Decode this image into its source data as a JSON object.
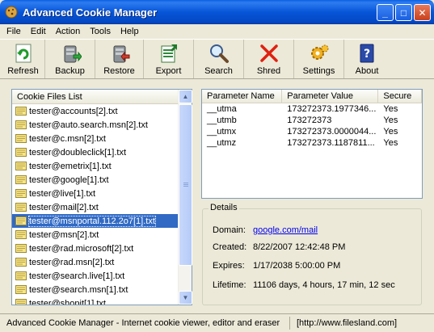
{
  "window": {
    "title": "Advanced Cookie Manager",
    "minimize": "_",
    "maximize": "□",
    "close": "✕"
  },
  "menu": [
    "File",
    "Edit",
    "Action",
    "Tools",
    "Help"
  ],
  "toolbar": [
    {
      "label": "Refresh",
      "icon": "refresh-icon"
    },
    {
      "label": "Backup",
      "icon": "backup-icon"
    },
    {
      "label": "Restore",
      "icon": "restore-icon"
    },
    {
      "label": "Export",
      "icon": "export-icon"
    },
    {
      "label": "Search",
      "icon": "search-icon"
    },
    {
      "label": "Shred",
      "icon": "shred-icon"
    },
    {
      "label": "Settings",
      "icon": "settings-icon"
    },
    {
      "label": "About",
      "icon": "about-icon"
    }
  ],
  "cookie_list": {
    "header": "Cookie Files List",
    "selected_index": 8,
    "files": [
      "tester@accounts[2].txt",
      "tester@auto.search.msn[2].txt",
      "tester@c.msn[2].txt",
      "tester@doubleclick[1].txt",
      "tester@emetrix[1].txt",
      "tester@google[1].txt",
      "tester@live[1].txt",
      "tester@mail[2].txt",
      "tester@msnportal.112.2o7[1].txt",
      "tester@msn[2].txt",
      "tester@rad.microsoft[2].txt",
      "tester@rad.msn[2].txt",
      "tester@search.live[1].txt",
      "tester@search.msn[1].txt",
      "tester@shopit[1].txt"
    ]
  },
  "params": {
    "headers": [
      "Parameter Name",
      "Parameter Value",
      "Secure"
    ],
    "rows": [
      [
        "__utma",
        "173272373.1977346...",
        "Yes"
      ],
      [
        "__utmb",
        "173272373",
        "Yes"
      ],
      [
        "__utmx",
        "173272373.0000044...",
        "Yes"
      ],
      [
        "__utmz",
        "173272373.1187811...",
        "Yes"
      ]
    ]
  },
  "details": {
    "legend": "Details",
    "domain_label": "Domain:",
    "domain_value": "google.com/mail",
    "created_label": "Created:",
    "created_value": "8/22/2007 12:42:48 PM",
    "expires_label": "Expires:",
    "expires_value": "1/17/2038 5:00:00 PM",
    "lifetime_label": "Lifetime:",
    "lifetime_value": "11106 days, 4 hours, 17 min, 12 sec"
  },
  "status": {
    "main": "Advanced Cookie Manager - Internet cookie viewer, editor and eraser",
    "url": "[http://www.filesland.com]"
  }
}
